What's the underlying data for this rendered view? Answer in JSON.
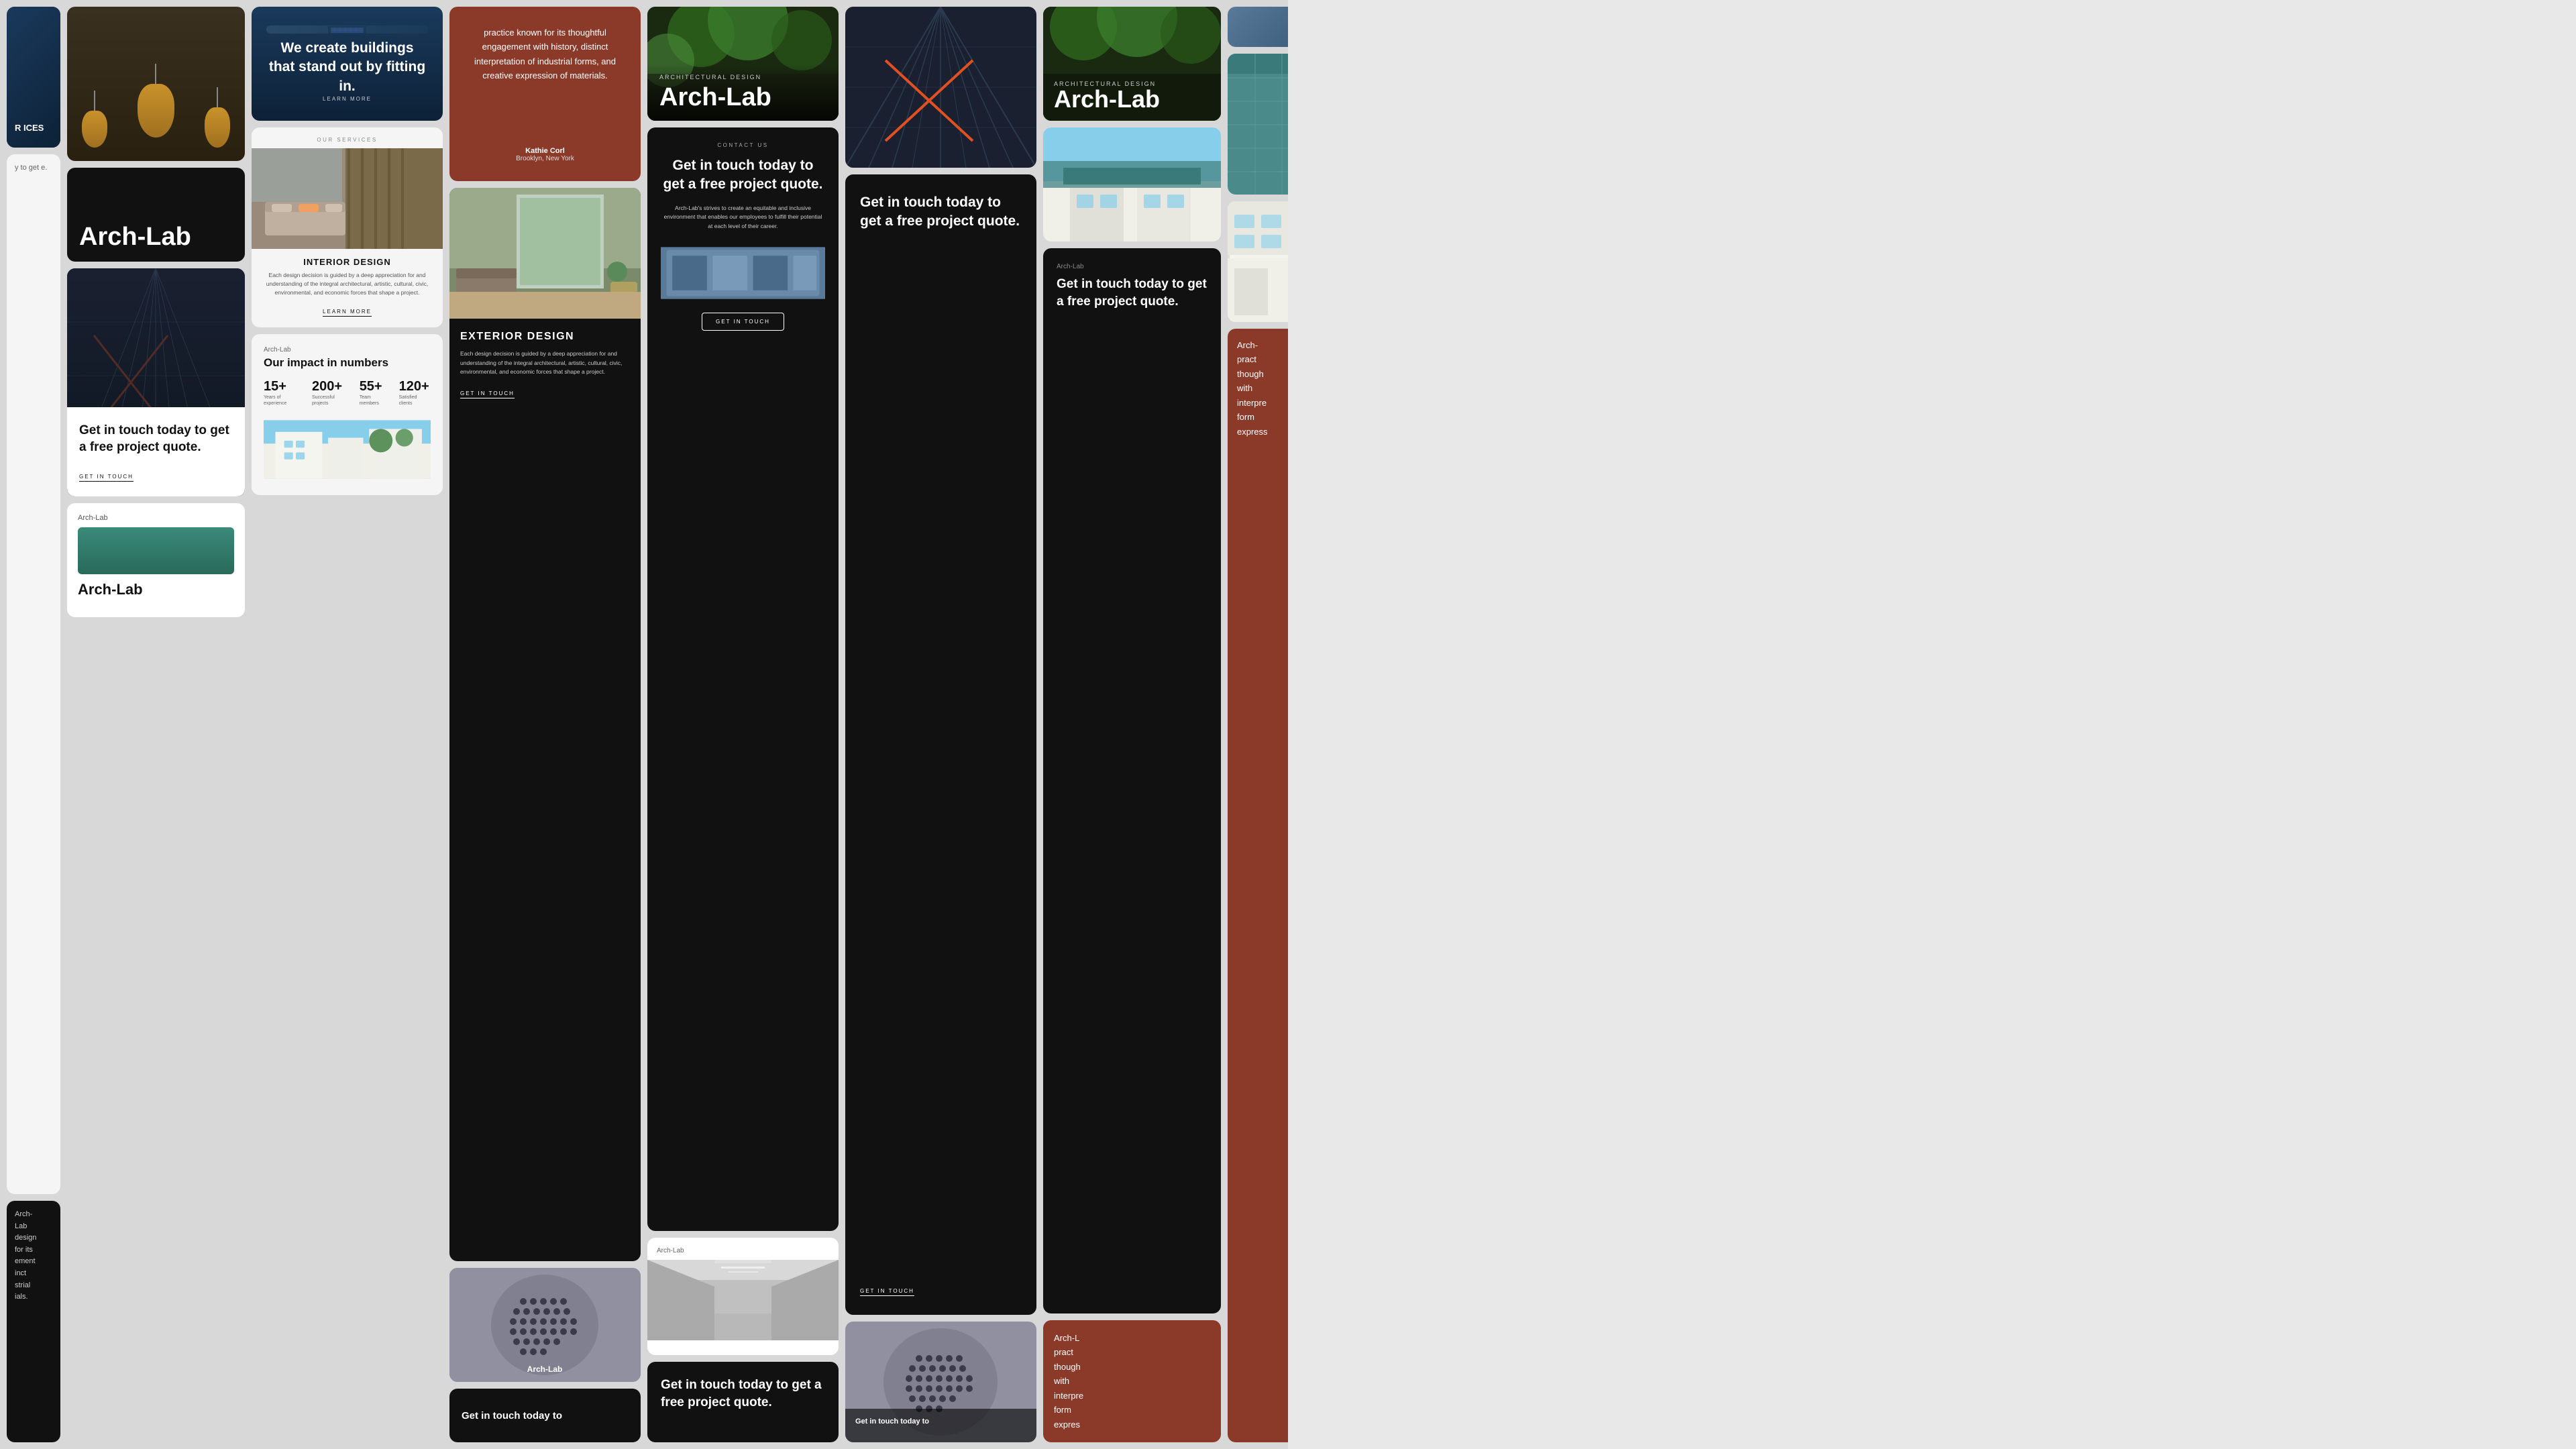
{
  "brand": {
    "name": "Arch-Lab",
    "tagline": "Architectural Design"
  },
  "col1": {
    "partial_text_1": "R ICES",
    "partial_text_2": "y to get e.",
    "partial_text_3": "Arch- Lab design for its ement inct strial ials."
  },
  "col2": {
    "pendant_alt": "Pendant lights",
    "archlab_logo": "Arch-Lab",
    "archlab_logo2": "Arch-Lab"
  },
  "col3": {
    "quote": "We create buildings that stand out by fitting in.",
    "quote_cta": "LEARN MORE",
    "services_label": "OUR SERVICES",
    "interior_title": "INTERIOR DESIGN",
    "interior_desc": "Each design decision is guided by a deep appreciation for and understanding of the integral architectural, artistic, cultural, civic, environmental, and economic forces that shape a project.",
    "interior_cta": "LEARN MORE",
    "archlab_label": "Arch-Lab",
    "impact_title": "Our impact in numbers",
    "stat1_num": "15+",
    "stat1_label": "Years of experience",
    "stat2_num": "200+",
    "stat2_label": "Successful projects",
    "stat3_num": "55+",
    "stat3_label": "Team members",
    "stat4_num": "120+",
    "stat4_label": "Satisfied clients"
  },
  "col4": {
    "testimonial": "practice known for its thoughtful engagement with history, distinct interpretation of industrial forms, and creative expression of materials.",
    "author_name": "Kathie Corl",
    "author_location": "Brooklyn, New York",
    "exterior_title": "EXTERIOR DESIGN",
    "exterior_desc": "Each design decision is guided by a deep appreciation for and understanding of the integral architectural, artistic, cultural, civic, environmental, and economic forces that shape a project.",
    "exterior_cta": "GET IN TOUCH",
    "round_building_alt": "Round perforated building",
    "get_in_touch_bottom": "Get in touch today to"
  },
  "col5": {
    "get_in_touch_title": "Get in touch today to get a free project quote.",
    "get_in_touch_cta": "GET IN TOUCH",
    "arch_design_label": "Architectural Design",
    "arch_design_title": "Arch-Lab",
    "contact_label": "CONTACT US",
    "contact_title": "Get in touch today to get a free project quote.",
    "contact_desc": "Arch-Lab's strives to create an equitable and inclusive environment that enables our employees to fulfill their potential at each level of their career.",
    "contact_cta": "GET IN TOUCH",
    "archlab_label2": "Arch-Lab",
    "archlab_contact2_title": "Get in touch today to get a free project quote."
  },
  "col6": {
    "skyscraper_alt": "Skyscraper building",
    "get_in_touch_title": "Get in touch today to get a free project quote.",
    "get_in_touch_cta": "GET IN TOUCH"
  },
  "col7": {
    "partial_arch": "Arch-L pract though with interpre form expres"
  },
  "colors": {
    "dark": "#111111",
    "accent_teal": "#4a9a8a",
    "accent_orange": "#e05020",
    "accent_brown": "#8B3A2A",
    "light_bg": "#f5f5f5",
    "grid_bg": "#d8d8d8"
  }
}
